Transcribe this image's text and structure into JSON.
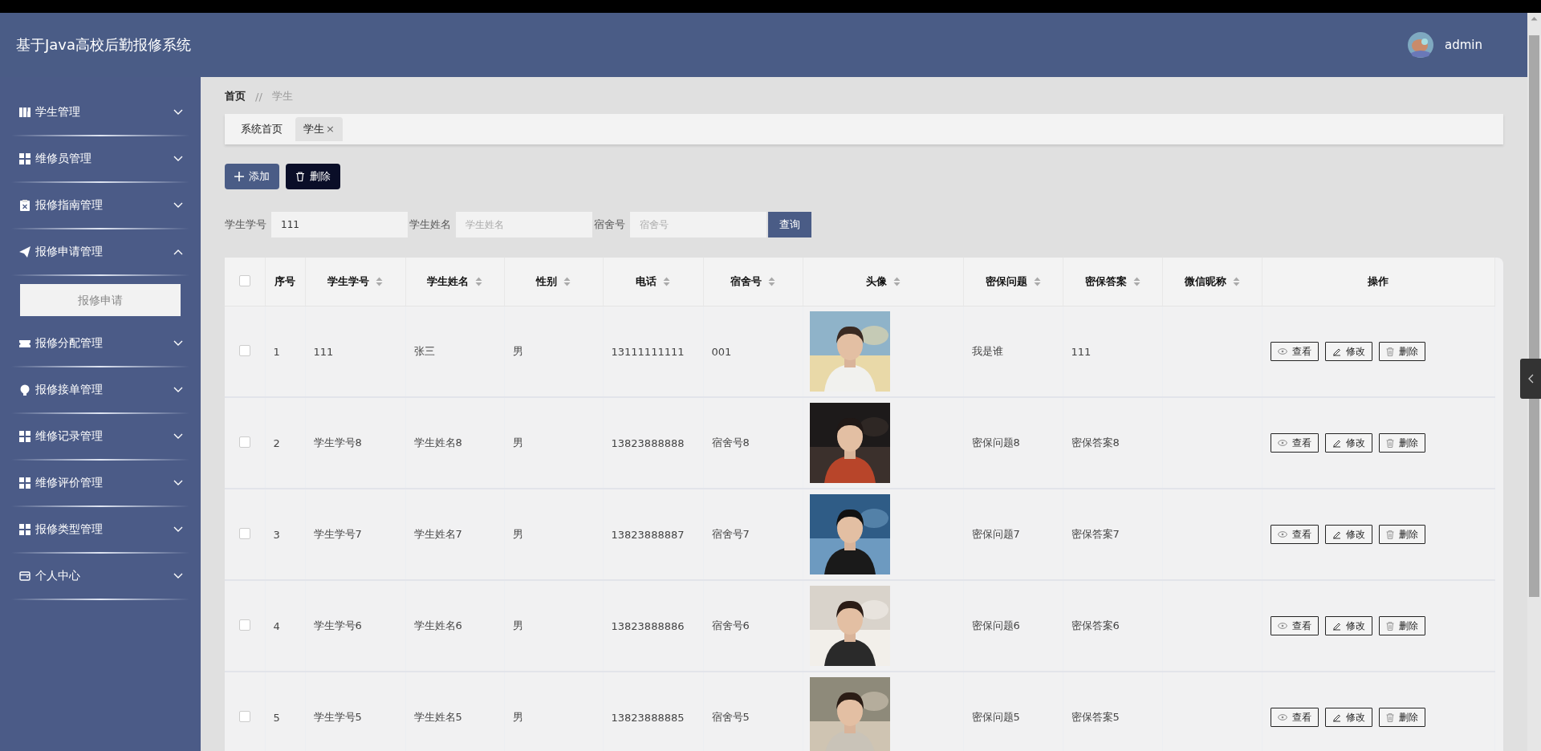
{
  "header": {
    "title": "基于Java高校后勤报修系统",
    "user": "admin"
  },
  "sidebar": {
    "items": [
      {
        "label": "学生管理",
        "expanded": false
      },
      {
        "label": "维修员管理",
        "expanded": false
      },
      {
        "label": "报修指南管理",
        "expanded": false
      },
      {
        "label": "报修申请管理",
        "expanded": true,
        "children": [
          {
            "label": "报修申请"
          }
        ]
      },
      {
        "label": "报修分配管理",
        "expanded": false
      },
      {
        "label": "报修接单管理",
        "expanded": false
      },
      {
        "label": "维修记录管理",
        "expanded": false
      },
      {
        "label": "维修评价管理",
        "expanded": false
      },
      {
        "label": "报修类型管理",
        "expanded": false
      },
      {
        "label": "个人中心",
        "expanded": false
      }
    ]
  },
  "breadcrumb": [
    "首页",
    "//",
    "学生"
  ],
  "tabs": [
    {
      "label": "系统首页",
      "selected": false
    },
    {
      "label": "学生",
      "selected": true,
      "close": "×"
    }
  ],
  "actions": [
    {
      "label": "添加",
      "kind": "add"
    },
    {
      "label": "删除",
      "kind": "delete"
    }
  ],
  "search": {
    "fields": [
      {
        "label": "学生学号",
        "value": "111"
      },
      {
        "label": "学生姓名",
        "placeholder": "学生姓名"
      },
      {
        "label": "宿舍号",
        "placeholder": "宿舍号"
      }
    ],
    "button": "查询"
  },
  "table": {
    "all_checked": false,
    "columns": [
      {
        "label": "序号",
        "sortable": false
      },
      {
        "label": "学生学号",
        "sortable": true
      },
      {
        "label": "学生姓名",
        "sortable": true
      },
      {
        "label": "性别",
        "sortable": true
      },
      {
        "label": "电话",
        "sortable": true
      },
      {
        "label": "宿舍号",
        "sortable": true
      },
      {
        "label": "头像",
        "sortable": true
      },
      {
        "label": "密保问题",
        "sortable": true
      },
      {
        "label": "密保答案",
        "sortable": true
      },
      {
        "label": "微信昵称",
        "sortable": true
      },
      {
        "label": "操作",
        "sortable": false
      }
    ],
    "rows": [
      {
        "checked": false,
        "cells": [
          "1",
          "111",
          "张三",
          "男",
          "13111111111",
          "001",
          {
            "kind": "picture"
          },
          "我是谁",
          "111"
        ],
        "actions": [
          "查看",
          "修改",
          "删除"
        ]
      },
      {
        "checked": false,
        "cells": [
          "2",
          "学生学号8",
          "学生姓名8",
          "男",
          "13823888888",
          "宿舍号8",
          {
            "kind": "picture"
          },
          "密保问题8",
          "密保答案8"
        ],
        "actions": [
          "查看",
          "修改",
          "删除"
        ]
      },
      {
        "checked": false,
        "cells": [
          "3",
          "学生学号7",
          "学生姓名7",
          "男",
          "13823888887",
          "宿舍号7",
          {
            "kind": "picture"
          },
          "密保问题7",
          "密保答案7"
        ],
        "actions": [
          "查看",
          "修改",
          "删除"
        ]
      },
      {
        "checked": false,
        "cells": [
          "4",
          "学生学号6",
          "学生姓名6",
          "男",
          "13823888886",
          "宿舍号6",
          {
            "kind": "picture"
          },
          "密保问题6",
          "密保答案6"
        ],
        "actions": [
          "查看",
          "修改",
          "删除"
        ]
      },
      {
        "checked": false,
        "cells": [
          "5",
          "学生学号5",
          "学生姓名5",
          "男",
          "13823888885",
          "宿舍号5",
          {
            "kind": "picture"
          },
          "密保问题5",
          "密保答案5"
        ],
        "actions": [
          "查看",
          "修改",
          "删除"
        ]
      }
    ]
  }
}
